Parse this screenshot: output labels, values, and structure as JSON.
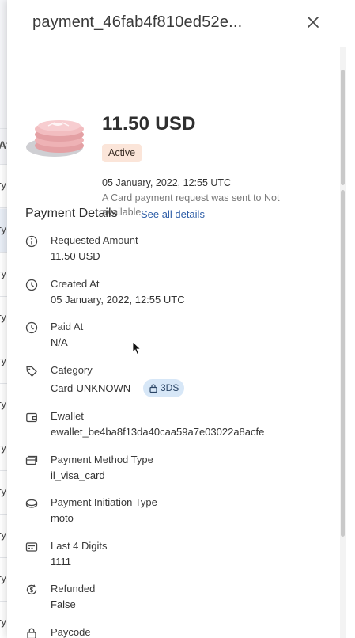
{
  "background": {
    "header_text": "At",
    "row_text": "ry"
  },
  "drawer": {
    "title": "payment_46fab4f810ed52e...",
    "close_icon": "close-icon"
  },
  "summary": {
    "amount": "11.50 USD",
    "status": "Active",
    "date": "05 January, 2022, 12:55 UTC",
    "description": "A Card payment request was sent to Not available",
    "colors": {
      "status_bg": "#fbe5d9",
      "coin": "#e8a7a7"
    }
  },
  "details": {
    "title": "Payment Details",
    "see_all": "See all details",
    "fields": [
      {
        "label": "Requested Amount",
        "value": "11.50 USD",
        "icon": "info-icon"
      },
      {
        "label": "Created At",
        "value": "05 January, 2022, 12:55 UTC",
        "icon": "clock-icon"
      },
      {
        "label": "Paid At",
        "value": "N/A",
        "icon": "clock-icon"
      },
      {
        "label": "Category",
        "value": "Card-UNKNOWN",
        "icon": "tag-icon",
        "badge": "3DS"
      },
      {
        "label": "Ewallet",
        "value": "ewallet_be4ba8f13da40caa59a7e03022a8acfe",
        "icon": "wallet-icon"
      },
      {
        "label": "Payment Method Type",
        "value": "il_visa_card",
        "icon": "card-icon"
      },
      {
        "label": "Payment Initiation Type",
        "value": "moto",
        "icon": "coin-icon"
      },
      {
        "label": "Last 4 Digits",
        "value": "1111",
        "icon": "card-digits-icon"
      },
      {
        "label": "Refunded",
        "value": "False",
        "icon": "refund-icon"
      },
      {
        "label": "Paycode",
        "value": "",
        "icon": "lock-icon"
      }
    ]
  },
  "accent_color": "#2f5fa8"
}
